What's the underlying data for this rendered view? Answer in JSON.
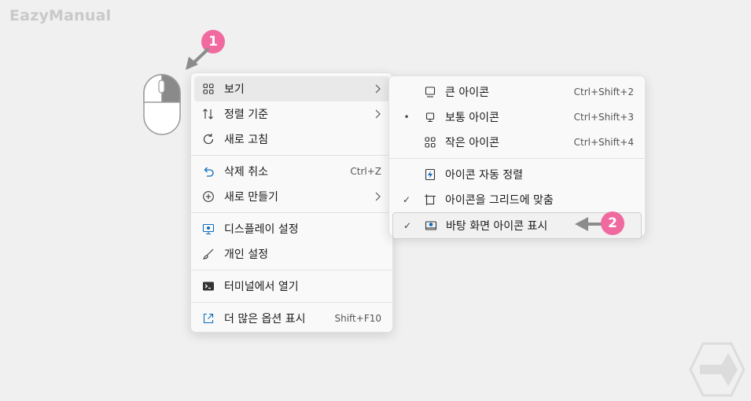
{
  "brand": "EazyManual",
  "badges": {
    "first": "1",
    "second": "2"
  },
  "context_menu": {
    "items": [
      {
        "label": "보기",
        "icon": "grid-icon",
        "submenu": true
      },
      {
        "label": "정렬 기준",
        "icon": "sort-icon",
        "submenu": true
      },
      {
        "label": "새로 고침",
        "icon": "refresh-icon"
      },
      {
        "label": "삭제 취소",
        "icon": "undo-icon",
        "shortcut": "Ctrl+Z"
      },
      {
        "label": "새로 만들기",
        "icon": "plus-circle-icon",
        "submenu": true
      },
      {
        "label": "디스플레이 설정",
        "icon": "display-icon"
      },
      {
        "label": "개인 설정",
        "icon": "brush-icon"
      },
      {
        "label": "터미널에서 열기",
        "icon": "terminal-icon"
      },
      {
        "label": "더 많은 옵션 표시",
        "icon": "share-icon",
        "shortcut": "Shift+F10"
      }
    ]
  },
  "view_submenu": {
    "items": [
      {
        "label": "큰 아이콘",
        "icon": "monitor-icon",
        "shortcut": "Ctrl+Shift+2",
        "mark": ""
      },
      {
        "label": "보통 아이콘",
        "icon": "monitor-icon",
        "shortcut": "Ctrl+Shift+3",
        "mark": "•"
      },
      {
        "label": "작은 아이콘",
        "icon": "grid-icon",
        "shortcut": "Ctrl+Shift+4",
        "mark": ""
      },
      {
        "label": "아이콘 자동 정렬",
        "icon": "auto-arrange-icon",
        "mark": ""
      },
      {
        "label": "아이콘을 그리드에 맞춤",
        "icon": "align-grid-icon",
        "mark": "✓"
      },
      {
        "label": "바탕 화면 아이콘 표시",
        "icon": "desktop-icon",
        "mark": "✓"
      }
    ]
  },
  "colors": {
    "badge": "#f06aa0",
    "accent": "#0f6cbd",
    "menu_bg": "#f9f9f9"
  }
}
